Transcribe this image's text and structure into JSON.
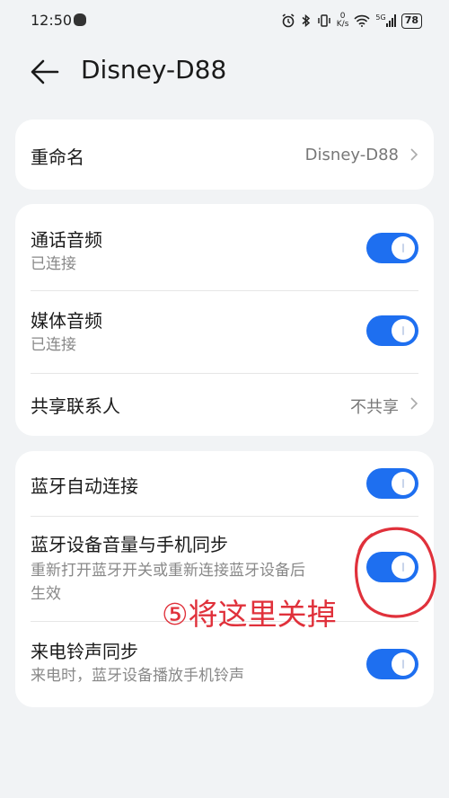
{
  "status_bar": {
    "time": "12:50",
    "speed_value": "0",
    "speed_unit": "K/s",
    "network": "5G",
    "battery": "78"
  },
  "header": {
    "title": "Disney-D88"
  },
  "card1": {
    "rename_label": "重命名",
    "rename_value": "Disney-D88"
  },
  "card2": {
    "call_audio_label": "通话音频",
    "call_audio_status": "已连接",
    "call_audio_on": true,
    "media_audio_label": "媒体音频",
    "media_audio_status": "已连接",
    "media_audio_on": true,
    "share_contacts_label": "共享联系人",
    "share_contacts_value": "不共享"
  },
  "card3": {
    "auto_connect_label": "蓝牙自动连接",
    "auto_connect_on": true,
    "volume_sync_label": "蓝牙设备音量与手机同步",
    "volume_sync_desc_line1": "重新打开蓝牙开关或重新连接蓝牙设备后",
    "volume_sync_desc_line2": "生效",
    "volume_sync_on": true,
    "ringtone_sync_label": "来电铃声同步",
    "ringtone_sync_desc": "来电时，蓝牙设备播放手机铃声",
    "ringtone_sync_on": true
  },
  "annotation": {
    "text": "⑤将这里关掉",
    "color": "#e0313b"
  },
  "colors": {
    "accent": "#1e6ff0",
    "background": "#f1f3f5",
    "card": "#ffffff"
  }
}
